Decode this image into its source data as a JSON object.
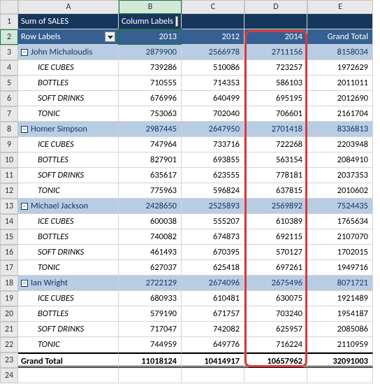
{
  "cols": {
    "A": "A",
    "B": "B",
    "C": "C",
    "D": "D",
    "E": "E"
  },
  "hdr": {
    "sum": "Sum of SALES",
    "col_labels": "Column Labels",
    "row_labels": "Row Labels",
    "y2013": "2013",
    "y2012": "2012",
    "y2014": "2014",
    "gt": "Grand Total"
  },
  "groups": [
    {
      "name": "John Michaloudis",
      "v": [
        "2879900",
        "2566978",
        "2711156",
        "8158034"
      ],
      "items": [
        {
          "n": "ICE CUBES",
          "v": [
            "739286",
            "510086",
            "723257",
            "1972629"
          ]
        },
        {
          "n": "BOTTLES",
          "v": [
            "710555",
            "714353",
            "586103",
            "2011011"
          ]
        },
        {
          "n": "SOFT DRINKS",
          "v": [
            "676996",
            "640499",
            "695195",
            "2012690"
          ]
        },
        {
          "n": "TONIC",
          "v": [
            "753063",
            "702040",
            "706601",
            "2161704"
          ]
        }
      ]
    },
    {
      "name": "Homer Simpson",
      "v": [
        "2987445",
        "2647950",
        "2701418",
        "8336813"
      ],
      "items": [
        {
          "n": "ICE CUBES",
          "v": [
            "747964",
            "733716",
            "722268",
            "2203948"
          ]
        },
        {
          "n": "BOTTLES",
          "v": [
            "827901",
            "693855",
            "563154",
            "2084910"
          ]
        },
        {
          "n": "SOFT DRINKS",
          "v": [
            "635617",
            "623555",
            "778181",
            "2037353"
          ]
        },
        {
          "n": "TONIC",
          "v": [
            "775963",
            "596824",
            "637815",
            "2010602"
          ]
        }
      ]
    },
    {
      "name": "Michael Jackson",
      "v": [
        "2428650",
        "2525893",
        "2569892",
        "7524435"
      ],
      "items": [
        {
          "n": "ICE CUBES",
          "v": [
            "600038",
            "555207",
            "610389",
            "1765634"
          ]
        },
        {
          "n": "BOTTLES",
          "v": [
            "740082",
            "674873",
            "692115",
            "2107070"
          ]
        },
        {
          "n": "SOFT DRINKS",
          "v": [
            "461493",
            "670395",
            "570127",
            "1702015"
          ]
        },
        {
          "n": "TONIC",
          "v": [
            "627037",
            "625418",
            "697261",
            "1949716"
          ]
        }
      ]
    },
    {
      "name": "Ian Wright",
      "v": [
        "2722129",
        "2674096",
        "2675496",
        "8071721"
      ],
      "items": [
        {
          "n": "ICE CUBES",
          "v": [
            "680933",
            "610481",
            "630075",
            "1921489"
          ]
        },
        {
          "n": "BOTTLES",
          "v": [
            "579190",
            "671757",
            "703240",
            "1954187"
          ]
        },
        {
          "n": "SOFT DRINKS",
          "v": [
            "717047",
            "742082",
            "625957",
            "2085086"
          ]
        },
        {
          "n": "TONIC",
          "v": [
            "744959",
            "649776",
            "716224",
            "2110959"
          ]
        }
      ]
    }
  ],
  "grand": {
    "label": "Grand Total",
    "v": [
      "11018124",
      "10414917",
      "10657962",
      "32091003"
    ]
  },
  "collapse": "−",
  "chart_data": {
    "type": "table",
    "title": "Sum of SALES",
    "columns": [
      "Row Labels",
      "2013",
      "2012",
      "2014",
      "Grand Total"
    ],
    "rows": [
      [
        "John Michaloudis",
        2879900,
        2566978,
        2711156,
        8158034
      ],
      [
        "  ICE CUBES",
        739286,
        510086,
        723257,
        1972629
      ],
      [
        "  BOTTLES",
        710555,
        714353,
        586103,
        2011011
      ],
      [
        "  SOFT DRINKS",
        676996,
        640499,
        695195,
        2012690
      ],
      [
        "  TONIC",
        753063,
        702040,
        706601,
        2161704
      ],
      [
        "Homer Simpson",
        2987445,
        2647950,
        2701418,
        8336813
      ],
      [
        "  ICE CUBES",
        747964,
        733716,
        722268,
        2203948
      ],
      [
        "  BOTTLES",
        827901,
        693855,
        563154,
        2084910
      ],
      [
        "  SOFT DRINKS",
        635617,
        623555,
        778181,
        2037353
      ],
      [
        "  TONIC",
        775963,
        596824,
        637815,
        2010602
      ],
      [
        "Michael Jackson",
        2428650,
        2525893,
        2569892,
        7524435
      ],
      [
        "  ICE CUBES",
        600038,
        555207,
        610389,
        1765634
      ],
      [
        "  BOTTLES",
        740082,
        674873,
        692115,
        2107070
      ],
      [
        "  SOFT DRINKS",
        461493,
        670395,
        570127,
        1702015
      ],
      [
        "  TONIC",
        627037,
        625418,
        697261,
        1949716
      ],
      [
        "Ian Wright",
        2722129,
        2674096,
        2675496,
        8071721
      ],
      [
        "  ICE CUBES",
        680933,
        610481,
        630075,
        1921489
      ],
      [
        "  BOTTLES",
        579190,
        671757,
        703240,
        1954187
      ],
      [
        "  SOFT DRINKS",
        717047,
        742082,
        625957,
        2085086
      ],
      [
        "  TONIC",
        744959,
        649776,
        716224,
        2110959
      ],
      [
        "Grand Total",
        11018124,
        10414917,
        10657962,
        32091003
      ]
    ]
  }
}
